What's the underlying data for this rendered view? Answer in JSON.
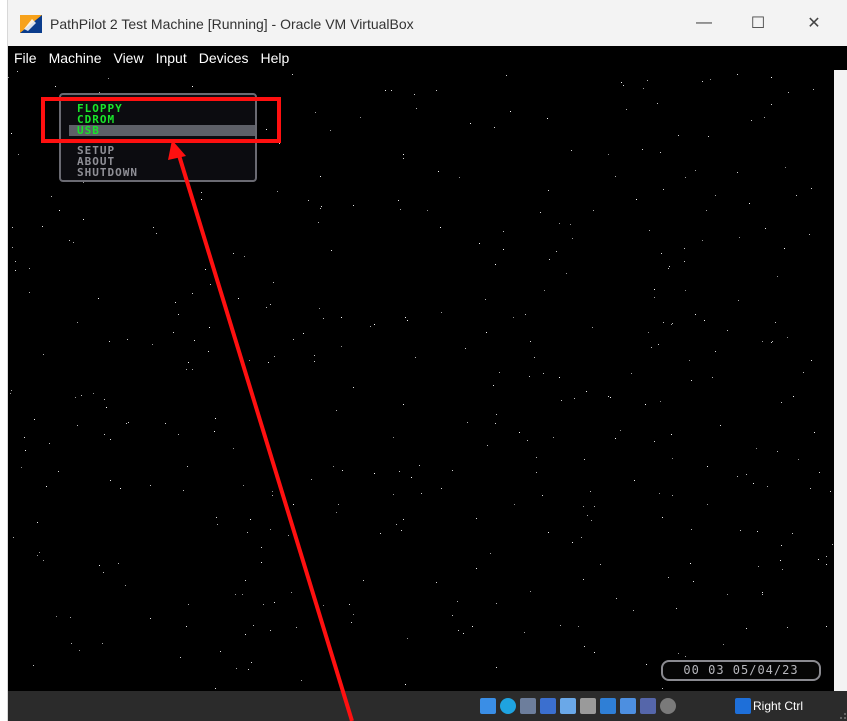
{
  "window": {
    "title": "PathPilot 2 Test Machine [Running] - Oracle VM VirtualBox",
    "controls": {
      "minimize": "—",
      "maximize": "☐",
      "close": "✕"
    }
  },
  "menubar": {
    "items": [
      "File",
      "Machine",
      "View",
      "Input",
      "Devices",
      "Help"
    ]
  },
  "boot_menu": {
    "items": [
      {
        "label": "FLOPPY",
        "color": "#19e52a",
        "selected": false
      },
      {
        "label": "CDROM",
        "color": "#19e52a",
        "selected": false
      },
      {
        "label": "USB",
        "color": "#19e52a",
        "selected": true
      },
      {
        "label": "SETUP",
        "color": "#8f8f96",
        "selected": false
      },
      {
        "label": "ABOUT",
        "color": "#8f8f96",
        "selected": false
      },
      {
        "label": "SHUTDOWN",
        "color": "#8f8f96",
        "selected": false
      }
    ]
  },
  "clock": {
    "text": "00 03 05/04/23"
  },
  "statusbar": {
    "icons": [
      "hard-disk-icon",
      "optical-drive-icon",
      "audio-icon",
      "network-icon",
      "usb-icon",
      "shared-folders-icon",
      "display-icon",
      "recording-icon",
      "vt-x-icon",
      "mouse-integration-icon"
    ],
    "host_key": "Right Ctrl"
  },
  "annotation": {
    "color": "#ff1010"
  }
}
